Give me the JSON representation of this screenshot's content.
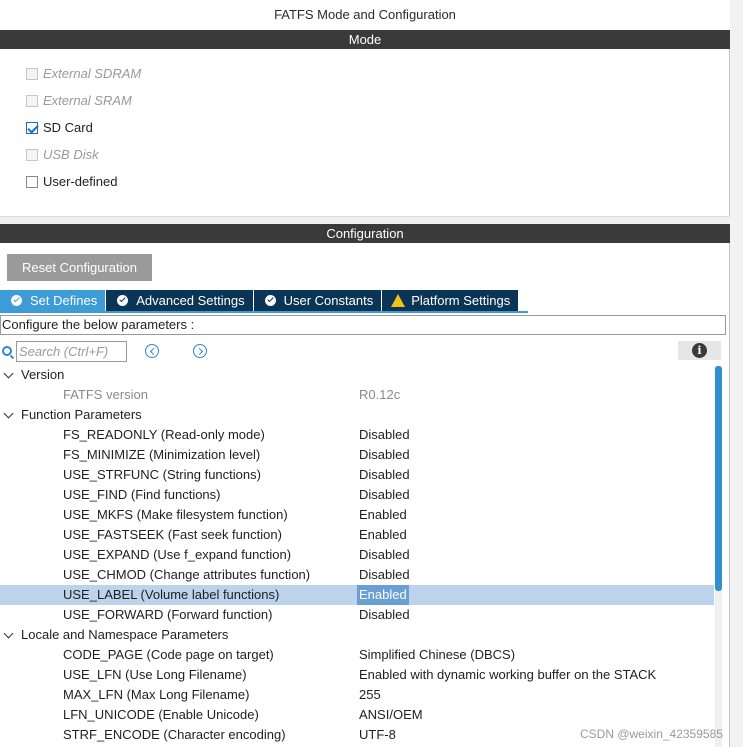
{
  "window": {
    "title": "FATFS Mode and Configuration"
  },
  "mode": {
    "header": "Mode",
    "items": [
      {
        "label": "External SDRAM",
        "checked": false,
        "enabled": false
      },
      {
        "label": "External SRAM",
        "checked": false,
        "enabled": false
      },
      {
        "label": "SD Card",
        "checked": true,
        "enabled": true
      },
      {
        "label": "USB Disk",
        "checked": false,
        "enabled": false
      },
      {
        "label": "User-defined",
        "checked": false,
        "enabled": true
      }
    ]
  },
  "configuration": {
    "header": "Configuration",
    "reset_label": "Reset Configuration",
    "tabs": [
      {
        "label": "Set Defines",
        "icon": "check-circle-icon",
        "active": true
      },
      {
        "label": "Advanced Settings",
        "icon": "check-circle-icon",
        "active": false
      },
      {
        "label": "User Constants",
        "icon": "check-circle-icon",
        "active": false
      },
      {
        "label": "Platform Settings",
        "icon": "warning-icon",
        "active": false
      }
    ],
    "configure_text": "Configure the below parameters :",
    "search": {
      "placeholder": "Search (Ctrl+F)"
    },
    "info_label": "i",
    "tree": {
      "groups": [
        {
          "label": "Version",
          "params": [
            {
              "name": "FATFS version",
              "value": "R0.12c",
              "readonly": true
            }
          ]
        },
        {
          "label": "Function Parameters",
          "params": [
            {
              "name": "FS_READONLY (Read-only mode)",
              "value": "Disabled"
            },
            {
              "name": "FS_MINIMIZE (Minimization level)",
              "value": "Disabled"
            },
            {
              "name": "USE_STRFUNC (String functions)",
              "value": "Disabled"
            },
            {
              "name": "USE_FIND (Find functions)",
              "value": "Disabled"
            },
            {
              "name": "USE_MKFS (Make filesystem function)",
              "value": "Enabled"
            },
            {
              "name": "USE_FASTSEEK (Fast seek function)",
              "value": "Enabled"
            },
            {
              "name": "USE_EXPAND (Use f_expand function)",
              "value": "Disabled"
            },
            {
              "name": "USE_CHMOD (Change attributes function)",
              "value": "Disabled"
            },
            {
              "name": "USE_LABEL (Volume label functions)",
              "value": "Enabled",
              "selected": true
            },
            {
              "name": "USE_FORWARD (Forward function)",
              "value": "Disabled"
            }
          ]
        },
        {
          "label": "Locale and Namespace Parameters",
          "params": [
            {
              "name": "CODE_PAGE (Code page on target)",
              "value": "Simplified Chinese (DBCS)"
            },
            {
              "name": "USE_LFN (Use Long Filename)",
              "value": "Enabled with dynamic working buffer on the STACK"
            },
            {
              "name": "MAX_LFN (Max Long Filename)",
              "value": "255"
            },
            {
              "name": "LFN_UNICODE (Enable Unicode)",
              "value": "ANSI/OEM"
            },
            {
              "name": "STRF_ENCODE (Character encoding)",
              "value": "UTF-8"
            }
          ]
        }
      ]
    }
  },
  "watermark": "CSDN @weixin_42359585",
  "colors": {
    "section_bar": "#3a3a3a",
    "tab_active": "#3d9bd8",
    "tab_inactive": "#0b3556",
    "selection_row": "#bcd3ec",
    "accent": "#2f86c8",
    "warning": "#f2c21b"
  }
}
